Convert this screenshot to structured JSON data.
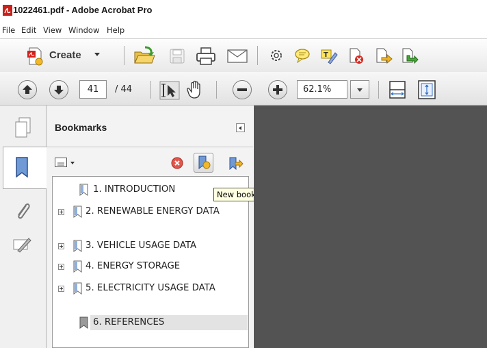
{
  "window": {
    "title": "1022461.pdf - Adobe Acrobat Pro"
  },
  "menu": [
    "File",
    "Edit",
    "View",
    "Window",
    "Help"
  ],
  "toolbar": {
    "create_label": "Create",
    "icons": [
      "create-pdf-icon",
      "open-folder-icon",
      "save-icon",
      "print-icon",
      "email-icon",
      "settings-gear-icon",
      "comment-bubble-icon",
      "highlight-text-icon",
      "delete-page-icon",
      "export-page-icon",
      "insert-page-icon"
    ]
  },
  "nav": {
    "current_page": "41",
    "total_pages": "/ 44",
    "zoom": "62.1%"
  },
  "panel": {
    "title": "Bookmarks",
    "tooltip": "New bookmark",
    "bookmarks": [
      {
        "label": "1. INTRODUCTION",
        "expandable": false
      },
      {
        "label": "2. RENEWABLE ENERGY DATA",
        "expandable": true
      },
      {
        "label": "3. VEHICLE USAGE DATA",
        "expandable": true
      },
      {
        "label": "4. ENERGY STORAGE",
        "expandable": true
      },
      {
        "label": "5. ELECTRICITY USAGE DATA",
        "expandable": true
      },
      {
        "label": "6. REFERENCES",
        "expandable": false,
        "selected": true
      }
    ]
  },
  "colors": {
    "document_background": "#535353",
    "tooltip_background": "#ffffe1",
    "accent_blue": "#2f6ec4"
  }
}
